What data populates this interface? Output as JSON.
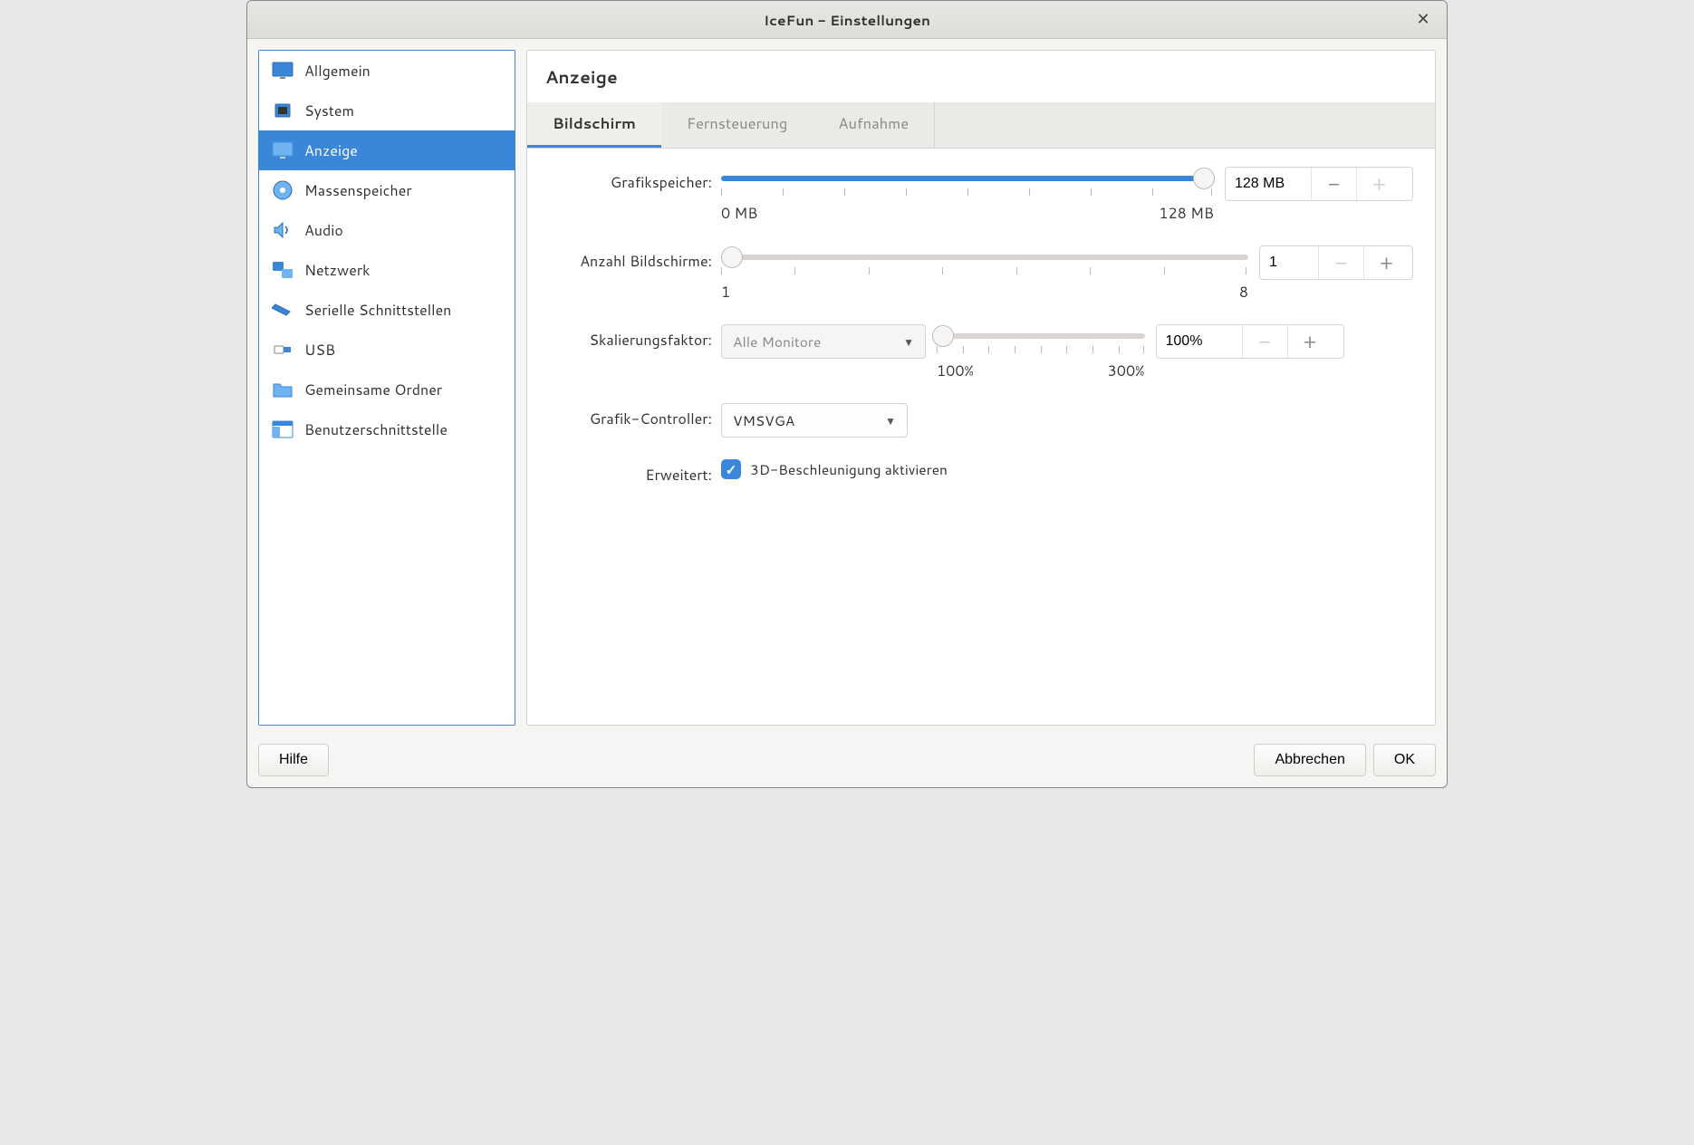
{
  "window": {
    "title": "IceFun - Einstellungen"
  },
  "sidebar": {
    "items": [
      {
        "label": "Allgemein"
      },
      {
        "label": "System"
      },
      {
        "label": "Anzeige"
      },
      {
        "label": "Massenspeicher"
      },
      {
        "label": "Audio"
      },
      {
        "label": "Netzwerk"
      },
      {
        "label": "Serielle Schnittstellen"
      },
      {
        "label": "USB"
      },
      {
        "label": "Gemeinsame Ordner"
      },
      {
        "label": "Benutzerschnittstelle"
      }
    ]
  },
  "main": {
    "title": "Anzeige",
    "tabs": [
      {
        "label": "Bildschirm"
      },
      {
        "label": "Fernsteuerung"
      },
      {
        "label": "Aufnahme"
      }
    ],
    "video_memory": {
      "label": "Grafikspeicher:",
      "min_label": "0 MB",
      "max_label": "128 MB",
      "value": "128 MB"
    },
    "monitors": {
      "label": "Anzahl Bildschirme:",
      "min_label": "1",
      "max_label": "8",
      "value": "1"
    },
    "scale": {
      "label": "Skalierungsfaktor:",
      "dropdown": "Alle Monitore",
      "min_label": "100%",
      "max_label": "300%",
      "value": "100%"
    },
    "controller": {
      "label": "Grafik-Controller:",
      "value": "VMSVGA"
    },
    "extended": {
      "label": "Erweitert:",
      "checkbox_label": "3D-Beschleunigung aktivieren"
    }
  },
  "footer": {
    "help": "Hilfe",
    "cancel": "Abbrechen",
    "ok": "OK"
  }
}
